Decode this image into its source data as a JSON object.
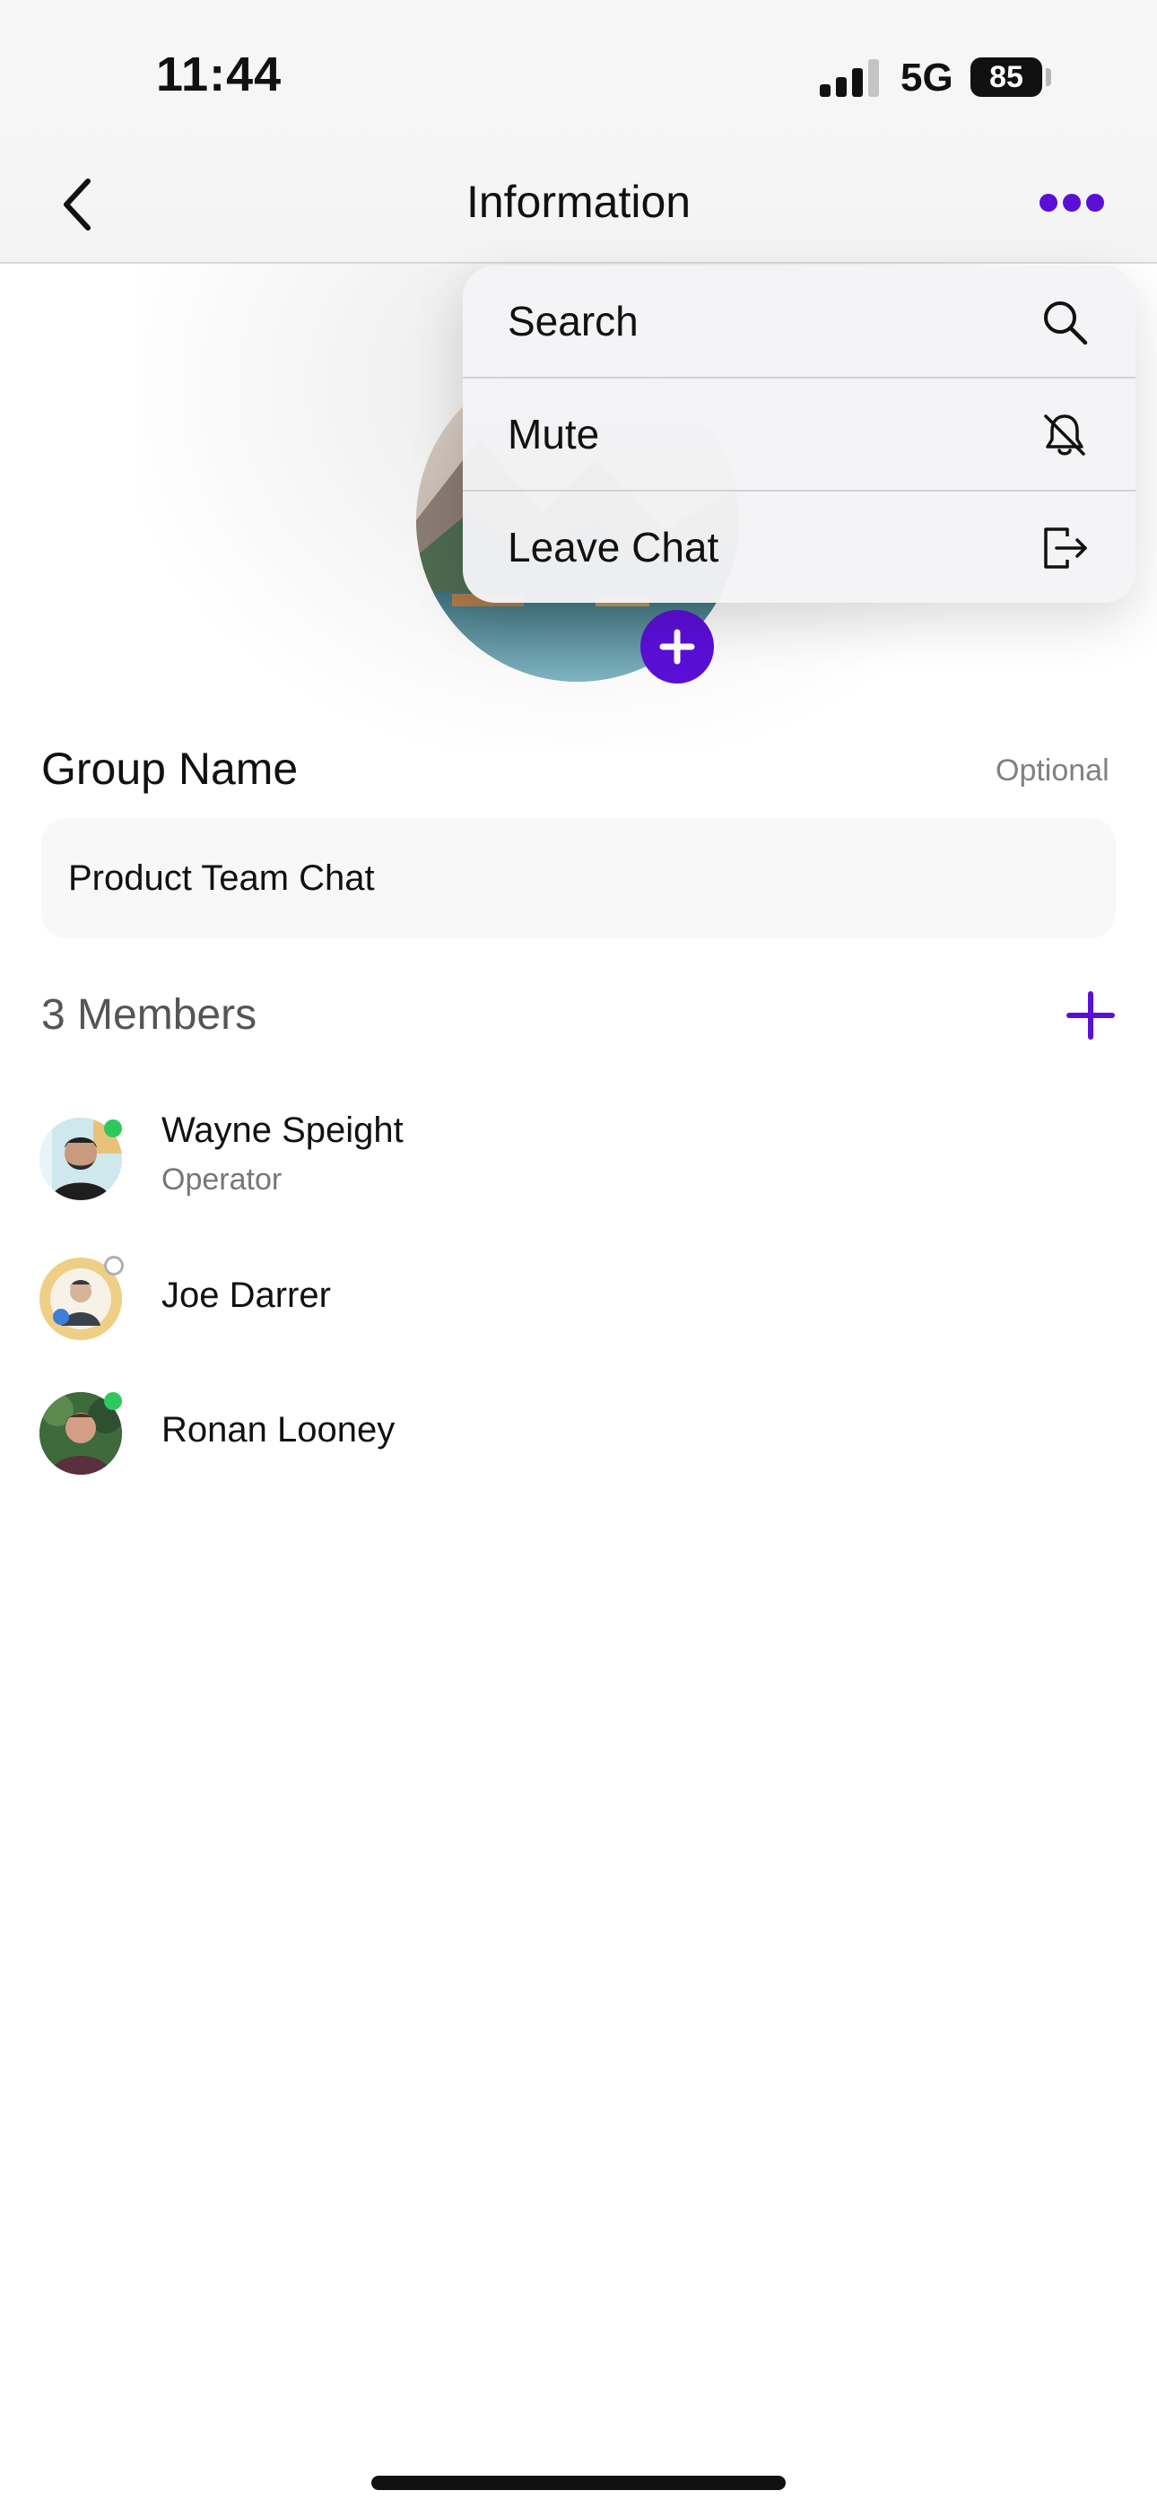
{
  "status_bar": {
    "time": "11:44",
    "network": "5G",
    "battery": "85"
  },
  "header": {
    "title": "Information"
  },
  "menu": {
    "items": [
      {
        "label": "Search",
        "icon": "search-icon"
      },
      {
        "label": "Mute",
        "icon": "bell-slash-icon"
      },
      {
        "label": "Leave Chat",
        "icon": "leave-icon"
      }
    ]
  },
  "group": {
    "name_label": "Group Name",
    "optional_label": "Optional",
    "name_value": "Product Team Chat"
  },
  "members": {
    "title": "3 Members",
    "list": [
      {
        "name": "Wayne Speight",
        "role": "Operator",
        "status": "online"
      },
      {
        "name": "Joe Darrer",
        "role": "",
        "status": "offline"
      },
      {
        "name": "Ronan Looney",
        "role": "",
        "status": "online"
      }
    ]
  },
  "colors": {
    "accent": "#5a0fd6",
    "online": "#2ec95c",
    "offline": "#b0b0b0"
  }
}
